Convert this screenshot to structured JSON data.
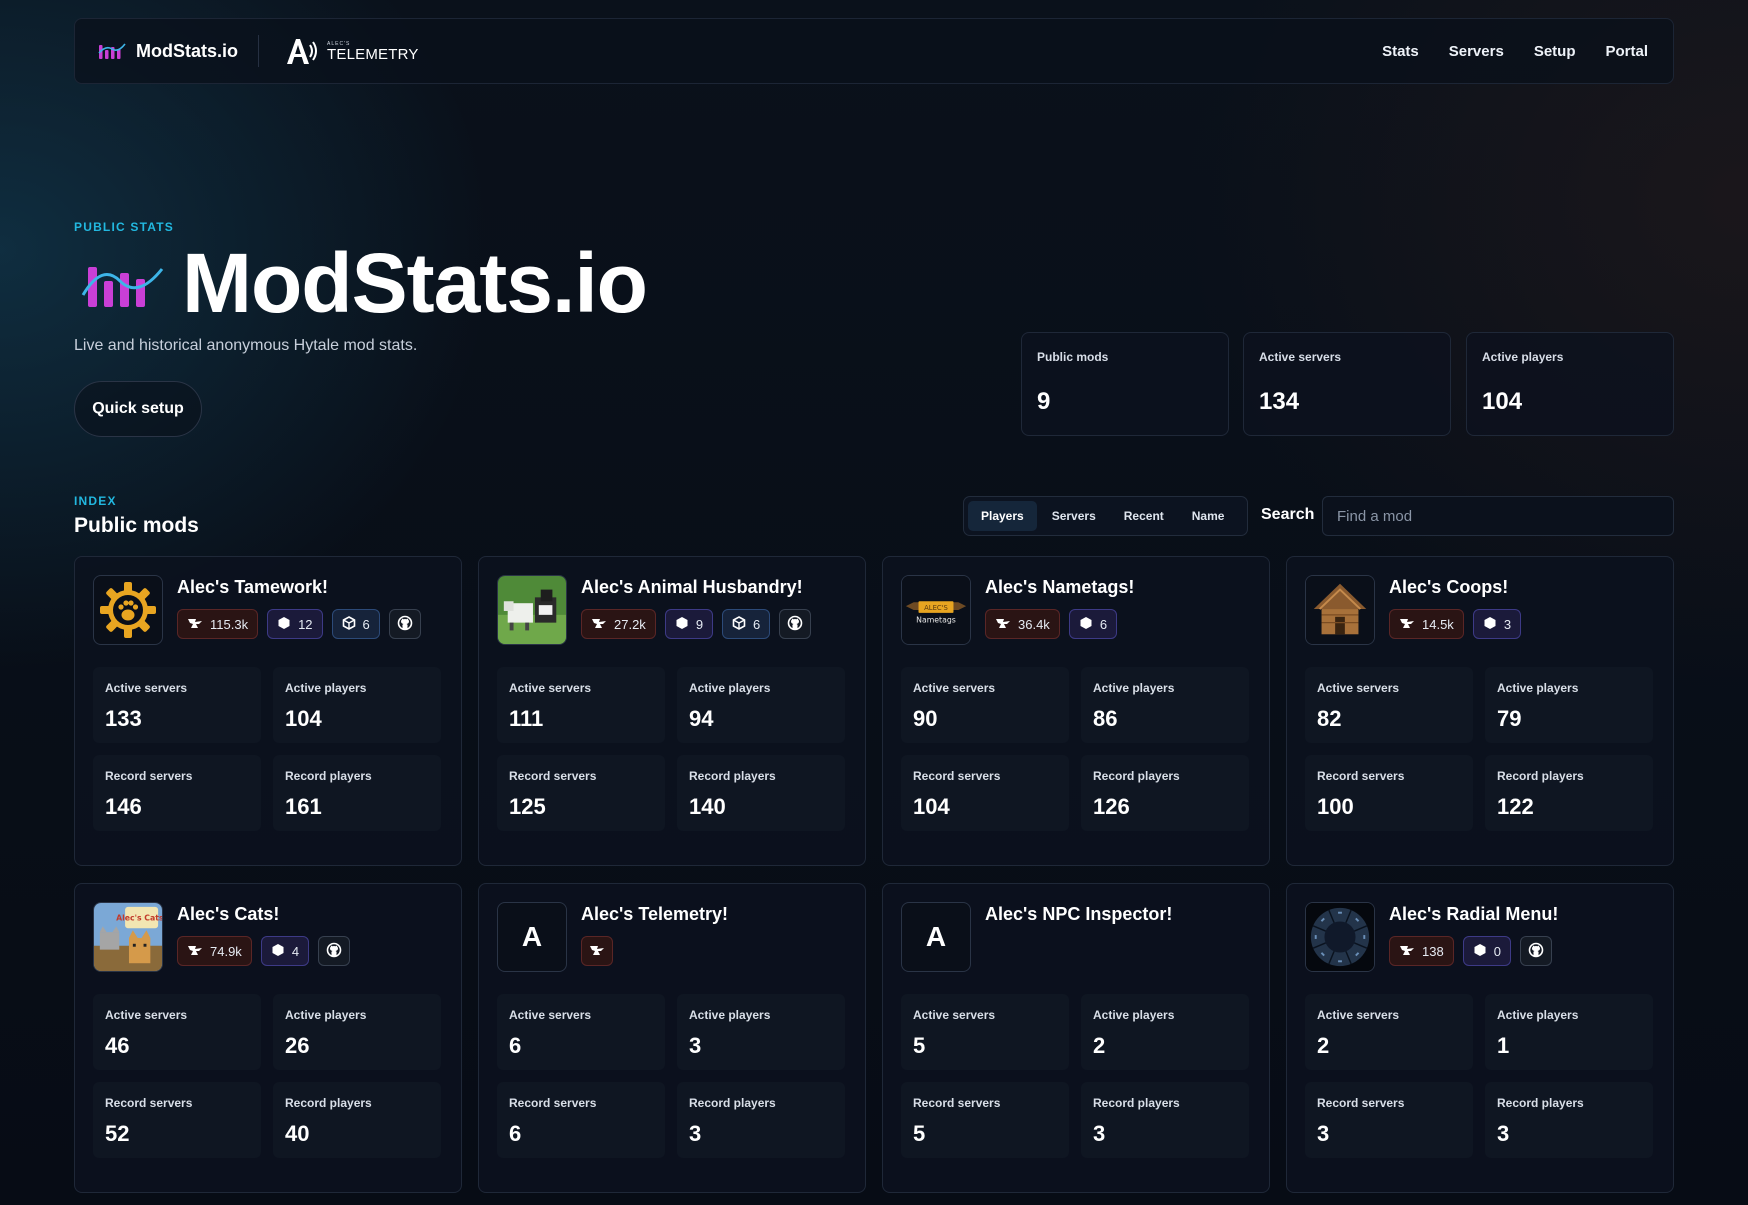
{
  "header": {
    "brand": "ModStats.io",
    "telemetry_small": "ALEC'S",
    "telemetry_big": "TELEMETRY",
    "nav": [
      "Stats",
      "Servers",
      "Setup",
      "Portal"
    ]
  },
  "hero": {
    "eyebrow": "PUBLIC STATS",
    "title": "ModStats.io",
    "subtitle": "Live and historical anonymous Hytale mod stats.",
    "cta": "Quick setup",
    "stats": [
      {
        "label": "Public mods",
        "value": "9"
      },
      {
        "label": "Active servers",
        "value": "134"
      },
      {
        "label": "Active players",
        "value": "104"
      }
    ]
  },
  "index": {
    "eyebrow": "INDEX",
    "title": "Public mods",
    "sort_tabs": [
      "Players",
      "Servers",
      "Recent",
      "Name"
    ],
    "active_tab": "Players",
    "search_label": "Search",
    "search_placeholder": "Find a mod"
  },
  "labels": {
    "active_servers": "Active servers",
    "active_players": "Active players",
    "record_servers": "Record servers",
    "record_players": "Record players"
  },
  "mods": [
    {
      "name": "Alec's Tamework!",
      "icon": "paw-gear-icon",
      "curseforge": "115.3k",
      "modrinth": "12",
      "other": "6",
      "github": true,
      "active_servers": "133",
      "active_players": "104",
      "record_servers": "146",
      "record_players": "161"
    },
    {
      "name": "Alec's Animal Husbandry!",
      "icon": "animals-icon",
      "curseforge": "27.2k",
      "modrinth": "9",
      "other": "6",
      "github": true,
      "active_servers": "111",
      "active_players": "94",
      "record_servers": "125",
      "record_players": "140"
    },
    {
      "name": "Alec's Nametags!",
      "icon": "nametag-icon",
      "icon_text_top": "ALEC'S",
      "icon_text_bottom": "Nametags",
      "curseforge": "36.4k",
      "modrinth": "6",
      "github": false,
      "active_servers": "90",
      "active_players": "86",
      "record_servers": "104",
      "record_players": "126"
    },
    {
      "name": "Alec's Coops!",
      "icon": "coop-icon",
      "curseforge": "14.5k",
      "modrinth": "3",
      "github": false,
      "active_servers": "82",
      "active_players": "79",
      "record_servers": "100",
      "record_players": "122"
    },
    {
      "name": "Alec's Cats!",
      "icon": "cats-icon",
      "icon_text": "Alec's Cats!",
      "curseforge": "74.9k",
      "modrinth": "4",
      "github": true,
      "active_servers": "46",
      "active_players": "26",
      "record_servers": "52",
      "record_players": "40"
    },
    {
      "name": "Alec's Telemetry!",
      "icon": "letter-a-icon",
      "icon_letter": "A",
      "curseforge_icon_only": true,
      "active_servers": "6",
      "active_players": "3",
      "record_servers": "6",
      "record_players": "3"
    },
    {
      "name": "Alec's NPC Inspector!",
      "icon": "letter-a-icon",
      "icon_letter": "A",
      "active_servers": "5",
      "active_players": "2",
      "record_servers": "5",
      "record_players": "3"
    },
    {
      "name": "Alec's Radial Menu!",
      "icon": "radial-menu-icon",
      "curseforge": "138",
      "modrinth": "0",
      "github": true,
      "active_servers": "2",
      "active_players": "1",
      "record_servers": "3",
      "record_players": "3"
    }
  ]
}
